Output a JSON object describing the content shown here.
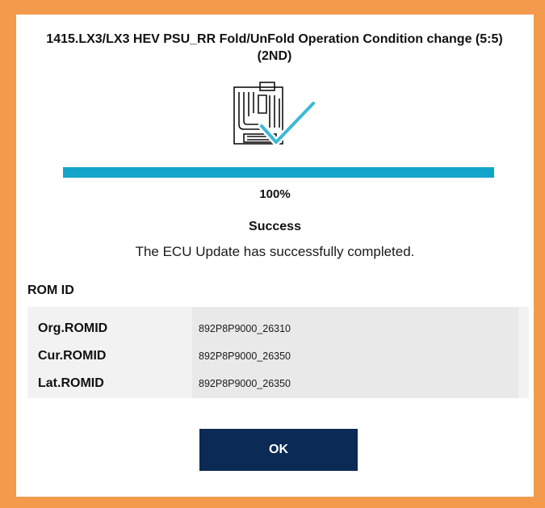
{
  "dialog": {
    "title": "1415.LX3/LX3 HEV PSU_RR Fold/UnFold Operation Condition change (5:5) (2ND)",
    "graphic_icon": "ecu-update-check-icon"
  },
  "progress": {
    "value": 1.0,
    "label": "100%",
    "color": "#12a5c9"
  },
  "status": {
    "title": "Success",
    "message": "The ECU Update has successfully completed."
  },
  "rom": {
    "heading": "ROM ID",
    "rows": [
      {
        "label": "Org.ROMID",
        "value": "892P8P9000_26310"
      },
      {
        "label": "Cur.ROMID",
        "value": "892P8P9000_26350"
      },
      {
        "label": "Lat.ROMID",
        "value": "892P8P9000_26350"
      }
    ]
  },
  "ok_button": {
    "label": "OK",
    "color": "#0b2a55"
  },
  "colors": {
    "frame": "#f39a4c",
    "accent_check": "#3cb9d6"
  }
}
